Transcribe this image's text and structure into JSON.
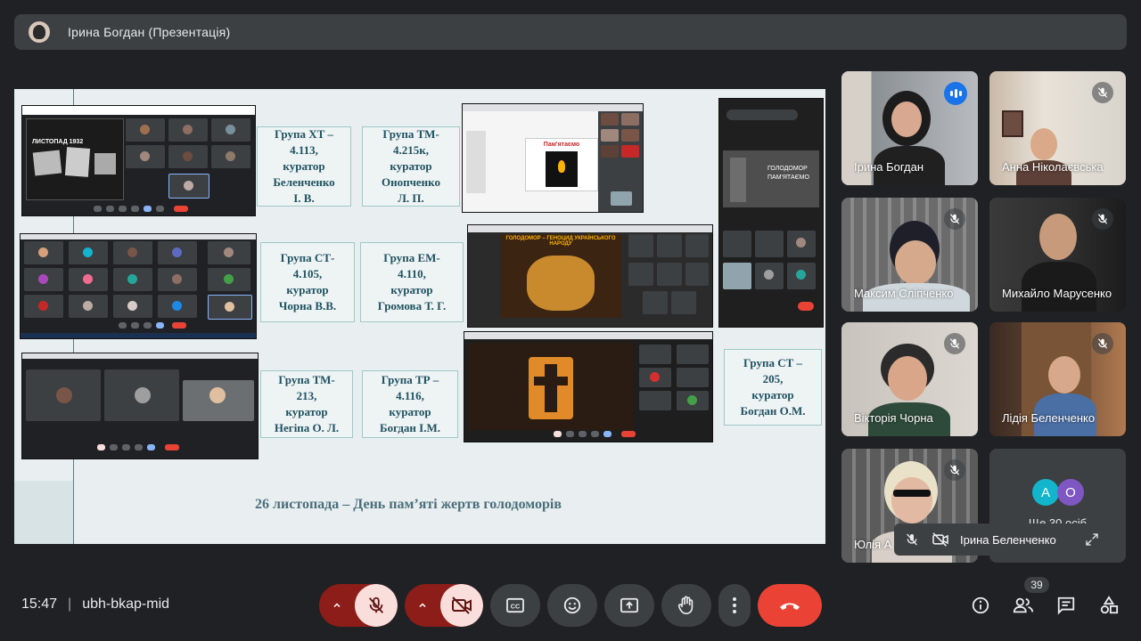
{
  "header": {
    "title": "Ірина Богдан (Презентація)"
  },
  "slide": {
    "groups": [
      "Група ХТ –\n4.113,\nкуратор\nБеленченко\nІ. В.",
      "Група ТМ-\n4.215к,\nкуратор\nОнопченко\nЛ. П.",
      "Група СТ-\n4.105,\nкуратор\nЧорна В.В.",
      "Група ЕМ-\n4.110,\nкуратор\nГромова Т. Г.",
      "Група ТМ-\n213,\nкуратор\nНегіпа О. Л.",
      "Група ТР –\n4.116,\nкуратор\nБогдан І.М.",
      "Група СТ –\n205,\nкуратор\nБогдан О.М."
    ],
    "caption": "26 листопада – День пам’яті жертв голодоморів",
    "inner_labels": {
      "poster": "ЛИСТОПАД 1932",
      "memory_title": "Пам'ятаємо",
      "holodomor_banner": "ГОЛОДОМОР – ГЕНОЦИД УКРАЇНСЬКОГО НАРОДУ",
      "phone_text": "ГОЛОДОМОР ПАМ'ЯТАЄМО"
    }
  },
  "participants": [
    {
      "name": "Ірина Богдан",
      "speaking": true
    },
    {
      "name": "Анна Ніколаєвська",
      "muted": true
    },
    {
      "name": "Максим Сліпченко",
      "muted": true
    },
    {
      "name": "Михайло Марусенко",
      "muted": true
    },
    {
      "name": "Вікторія Чорна",
      "muted": true
    },
    {
      "name": "Лідія Беленченко",
      "muted": true
    },
    {
      "name": "Юлія А",
      "muted": true
    }
  ],
  "more": {
    "initials": [
      "А",
      "О"
    ],
    "count_label": "Ще 30 осіб",
    "colors": [
      "#12b5cb",
      "#7e57c2"
    ]
  },
  "self_view": {
    "name": "Ірина Беленченко"
  },
  "bottom": {
    "time": "15:47",
    "meeting_code": "ubh-bkap-mid",
    "participants_badge": "39"
  },
  "colors": {
    "accent": "#8ab4f8",
    "end_call": "#ea4335",
    "muted_bg": "#f9dedc"
  }
}
